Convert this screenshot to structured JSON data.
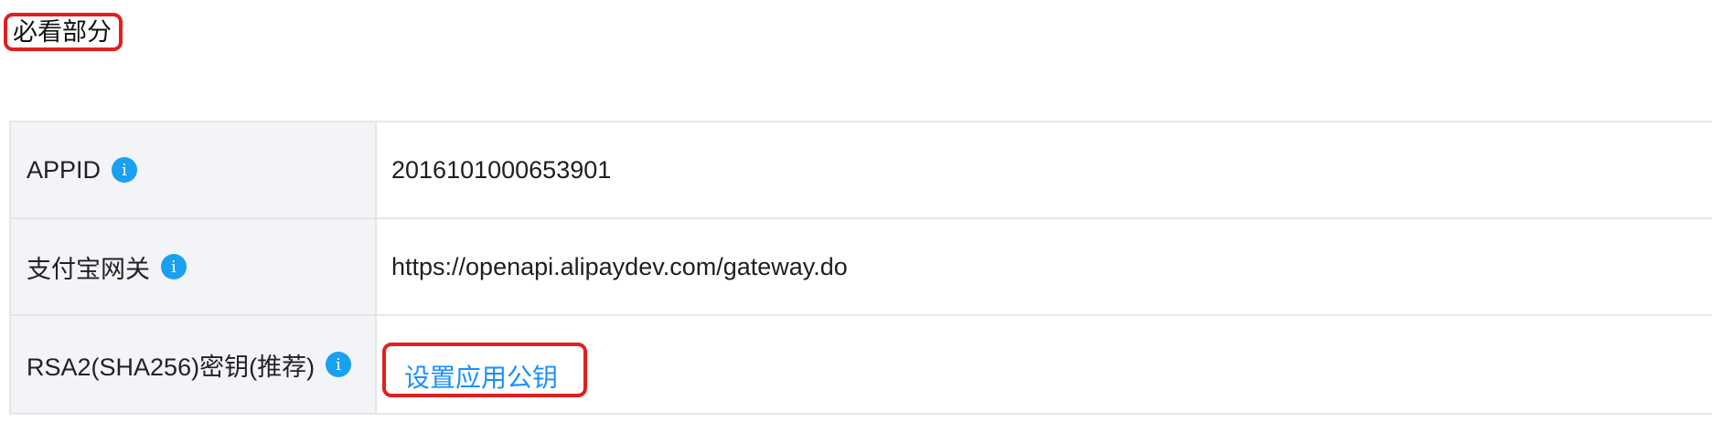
{
  "section": {
    "title": "必看部分"
  },
  "rows": [
    {
      "label": "APPID",
      "value": "2016101000653901"
    },
    {
      "label": "支付宝网关",
      "value": "https://openapi.alipaydev.com/gateway.do"
    },
    {
      "label": "RSA2(SHA256)密钥(推荐)",
      "link": "设置应用公钥"
    }
  ],
  "icons": {
    "info": "i"
  },
  "colors": {
    "highlight_border": "#e02020",
    "info_icon": "#1aa0f0",
    "link": "#1890ff",
    "label_bg": "#f3f4f8"
  }
}
